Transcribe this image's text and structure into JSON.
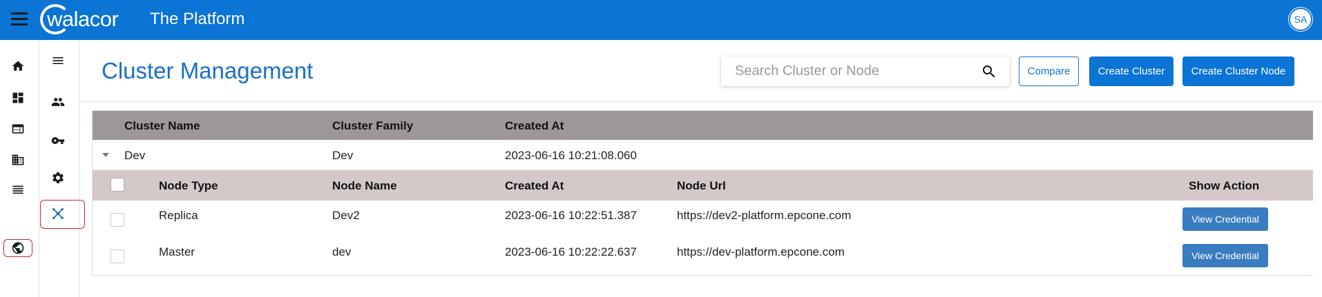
{
  "app": {
    "logo_text": "walacor",
    "title": "The Platform",
    "user_initials": "SA"
  },
  "page": {
    "title": "Cluster Management"
  },
  "search": {
    "placeholder": "Search Cluster or Node"
  },
  "actions": {
    "compare_label": "Compare",
    "create_cluster_label": "Create Cluster",
    "create_cluster_node_label": "Create Cluster Node"
  },
  "cluster_table": {
    "headers": [
      "Cluster Name",
      "Cluster Family",
      "Created At"
    ],
    "clusters": [
      {
        "name": "Dev",
        "family": "Dev",
        "created_at": "2023-06-16 10:21:08.060",
        "node_headers": [
          "Node Type",
          "Node Name",
          "Created At",
          "Node Url",
          "Show Action"
        ],
        "nodes": [
          {
            "type": "Replica",
            "name": "Dev2",
            "created_at": "2023-06-16 10:22:51.387",
            "url": "https://dev2-platform.epcone.com",
            "action_label": "View Credential"
          },
          {
            "type": "Master",
            "name": "dev",
            "created_at": "2023-06-16 10:22:22.637",
            "url": "https://dev-platform.epcone.com",
            "action_label": "View Credential"
          }
        ]
      }
    ]
  },
  "colors": {
    "brand": "#0b74d4",
    "title": "#1a6fc9",
    "header_primary": "#9e9797",
    "header_secondary": "#d5c8c8",
    "highlight": "#c62828"
  },
  "icons": {
    "rail1": [
      "home-icon",
      "dashboard-icon",
      "web-icon",
      "building-icon",
      "list-icon",
      "globe-icon"
    ],
    "rail2": [
      "menu-icon",
      "people-icon",
      "key-icon",
      "gear-icon",
      "cluster-icon"
    ]
  }
}
